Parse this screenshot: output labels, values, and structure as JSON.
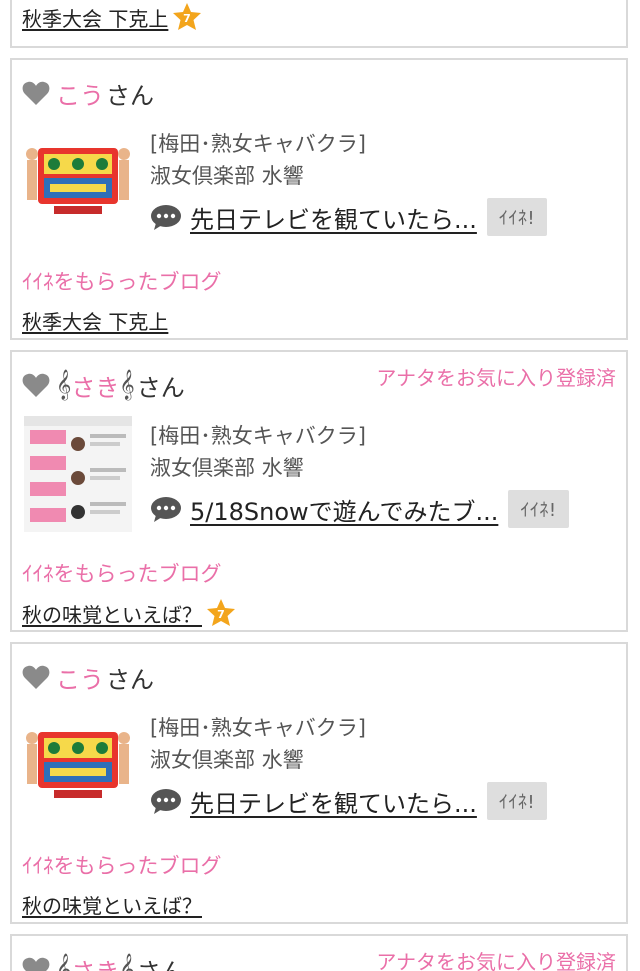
{
  "colors": {
    "accent_pink": "#ea6fa8",
    "badge_orange": "#f3a51c",
    "heart_gray": "#8a8a8a",
    "button_gray": "#dedede",
    "border_gray": "#d9d9d9"
  },
  "top_partial": {
    "blog_title": "秋季大会 下克上",
    "badge_icon": "star-7-badge-icon"
  },
  "cards": [
    {
      "heart_icon": "heart-icon",
      "user_name": "こう",
      "honorific": "さん",
      "favorite_status": "",
      "shop_category": "[梅田･熟女キャバクラ]",
      "shop_name": "淑女倶楽部 水響",
      "post_title": "先日テレビを観ていたら...",
      "iine_label": "ｲｲﾈ!",
      "section_label": "ｲｲﾈをもらったブログ",
      "blog_title": "秋季大会 下克上",
      "blog_badge": false
    },
    {
      "heart_icon": "heart-icon",
      "name_deco": "𝄞",
      "user_name": "さき",
      "honorific": "さん",
      "favorite_status": "アナタをお気に入り登録済",
      "shop_category": "[梅田･熟女キャバクラ]",
      "shop_name": "淑女倶楽部 水響",
      "post_title": "5/18Snowで遊んでみたブ...",
      "iine_label": "ｲｲﾈ!",
      "section_label": "ｲｲﾈをもらったブログ",
      "blog_title": "秋の味覚といえば？",
      "blog_badge": true
    },
    {
      "heart_icon": "heart-icon",
      "user_name": "こう",
      "honorific": "さん",
      "favorite_status": "",
      "shop_category": "[梅田･熟女キャバクラ]",
      "shop_name": "淑女倶楽部 水響",
      "post_title": "先日テレビを観ていたら...",
      "iine_label": "ｲｲﾈ!",
      "section_label": "ｲｲﾈをもらったブログ",
      "blog_title": "秋の味覚といえば？",
      "blog_badge": false
    },
    {
      "heart_icon": "heart-icon",
      "name_deco": "𝄞",
      "user_name": "さき",
      "honorific": "さん",
      "favorite_status": "アナタをお気に入り登録済"
    }
  ]
}
